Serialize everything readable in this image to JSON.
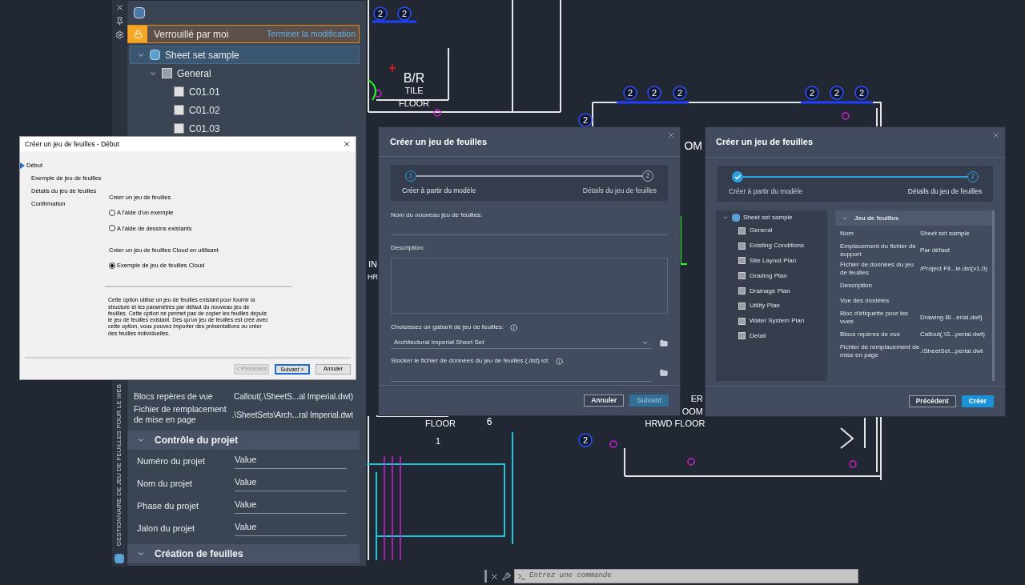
{
  "drawing": {
    "tags": [
      {
        "text": "2"
      },
      {
        "text": "2"
      },
      {
        "text": "2"
      },
      {
        "text": "2"
      },
      {
        "text": "2"
      },
      {
        "text": "2"
      },
      {
        "text": "2"
      },
      {
        "text": "2"
      },
      {
        "text": "2"
      },
      {
        "text": "2"
      }
    ],
    "labels": [
      {
        "text": "B/R"
      },
      {
        "text": "TILE"
      },
      {
        "text": "FLOOR"
      },
      {
        "text": "IN"
      },
      {
        "text": "HR"
      },
      {
        "text": "OM"
      },
      {
        "text": "ER"
      },
      {
        "text": "OOM"
      },
      {
        "text": "FLOOR"
      },
      {
        "text": "6"
      },
      {
        "text": "HRWD  FLOOR"
      },
      {
        "text": "1"
      }
    ]
  },
  "palette": {
    "title": "GESTIONNAIRE DE JEU DE FEUILLES POUR LE WEB",
    "lock": {
      "label": "Verrouillé par moi",
      "action": "Terminer la modification"
    },
    "tree": [
      {
        "label": "Sheet set sample",
        "kind": "set",
        "expanded": true,
        "selected": true,
        "children": [
          {
            "label": "General",
            "kind": "subset",
            "expanded": true,
            "selected": false,
            "children": [
              {
                "label": "C01.01",
                "kind": "sheet",
                "selected": false
              },
              {
                "label": "C01.02",
                "kind": "sheet",
                "selected": false
              },
              {
                "label": "C01.03",
                "kind": "sheet",
                "selected": false
              }
            ]
          }
        ]
      }
    ],
    "properties": [
      {
        "label": "Blocs repères de vue",
        "value": "Callout(.\\SheetS...al Imperial.dwt)"
      },
      {
        "label": "Fichier de remplacement de mise en page",
        "value": ".\\SheetSets\\Arch...ral Imperial.dwt"
      }
    ],
    "sections": [
      {
        "title": "Contrôle du projet",
        "expanded": true,
        "fields": [
          {
            "label": "Numéro du projet",
            "value": "Value"
          },
          {
            "label": "Nom du projet",
            "value": "Value"
          },
          {
            "label": "Phase du projet",
            "value": "Value"
          },
          {
            "label": "Jalon du projet",
            "value": "Value"
          }
        ]
      },
      {
        "title": "Création de feuilles",
        "expanded": true
      }
    ]
  },
  "wizard": {
    "title": "Créer un jeu de feuilles - Début",
    "steps": [
      {
        "label": "Début",
        "selected": true
      },
      {
        "label": "Exemple de jeu de feuilles",
        "selected": false
      },
      {
        "label": "Détails du jeu de feuilles",
        "selected": false
      },
      {
        "label": "Confirmation",
        "selected": false
      }
    ],
    "groups": [
      {
        "label": "Créer un jeu de feuilles",
        "options": [
          {
            "label": "A l'aide d'un exemple",
            "selected": false
          },
          {
            "label": "A l'aide de dessins existants",
            "selected": false
          }
        ]
      },
      {
        "label": "Créer un jeu de feuilles Cloud en utilisant",
        "options": [
          {
            "label": "Exemple de jeu de feuilles Cloud",
            "selected": true
          }
        ]
      }
    ],
    "description": "Cette option utilise un jeu de feuilles existant pour fournir la structure et les paramètres par défaut du nouveau jeu de feuilles. Cette option ne permet pas de copier les feuilles depuis le jeu de feuilles existant. Dès qu'un jeu de feuilles est créé avec cette option, vous pouvez importer des présentations ou créer des feuilles individuelles.",
    "buttons": [
      {
        "label": "< Précédent",
        "disabled": true,
        "focused": false
      },
      {
        "label": "Suivant >",
        "disabled": false,
        "focused": true
      },
      {
        "label": "Annuler",
        "disabled": false,
        "focused": false
      }
    ]
  },
  "create_dialog": {
    "title": "Créer un jeu de feuilles",
    "steps": [
      {
        "number": "1",
        "label": "Créer à partir du modèle",
        "completed": false,
        "active": true
      },
      {
        "number": "2",
        "label": "Détails du jeu de feuilles",
        "completed": false,
        "active": false
      }
    ],
    "name_label": "Nom du nouveau jeu de feuilles:",
    "description_label": "Description:",
    "template_label": "Choisissez un gabarit de jeu de feuilles:",
    "template_value": "Architectural Imperial Sheet Set",
    "store_label": "Stocker le fichier de données du jeu de feuilles (.dst) ici:",
    "buttons": [
      {
        "label": "Annuler",
        "primary": false,
        "disabled": false
      },
      {
        "label": "Suivant",
        "primary": true,
        "disabled": true
      }
    ]
  },
  "details_dialog": {
    "title": "Créer un jeu de feuilles",
    "steps": [
      {
        "label": "Créer à partir du modèle",
        "completed": true,
        "active": false
      },
      {
        "number": "2",
        "label": "Détails du jeu de feuilles",
        "completed": false,
        "active": true
      }
    ],
    "tree": {
      "label": "Sheet set sample",
      "expanded": true,
      "children": [
        {
          "label": "General"
        },
        {
          "label": "Existing Conditions"
        },
        {
          "label": "Site Layout Plan"
        },
        {
          "label": "Grading Plan"
        },
        {
          "label": "Drainage Plan"
        },
        {
          "label": "Utility Plan"
        },
        {
          "label": "Water System Plan"
        },
        {
          "label": "Detail"
        }
      ]
    },
    "section": {
      "title": "Jeu de feuilles",
      "expanded": true
    },
    "rows": [
      {
        "label": "Nom",
        "value": "Sheet set sample"
      },
      {
        "label": "Emplacement du fichier de support",
        "value": "Par défaut"
      },
      {
        "label": "Fichier de données du jeu de feuilles",
        "value": "/Project Fil...le.dst(v1.0)"
      },
      {
        "label": "Description"
      },
      {
        "label": "Vue des modèles"
      },
      {
        "label": "Bloc d'étiquette pour les vues",
        "value": "Drawing Bl...erial.dwt)"
      },
      {
        "label": "Blocs repères de vue",
        "value": "Callout(.\\S...perial.dwt)"
      },
      {
        "label": "Fichier de remplacement de mise en page",
        "value": ".\\SheetSet...perial.dwt"
      }
    ],
    "buttons": [
      {
        "label": "Précédent",
        "primary": false,
        "disabled": false
      },
      {
        "label": "Créer",
        "primary": true,
        "disabled": false
      }
    ]
  },
  "command_line": {
    "placeholder": "Entrez une commande"
  }
}
